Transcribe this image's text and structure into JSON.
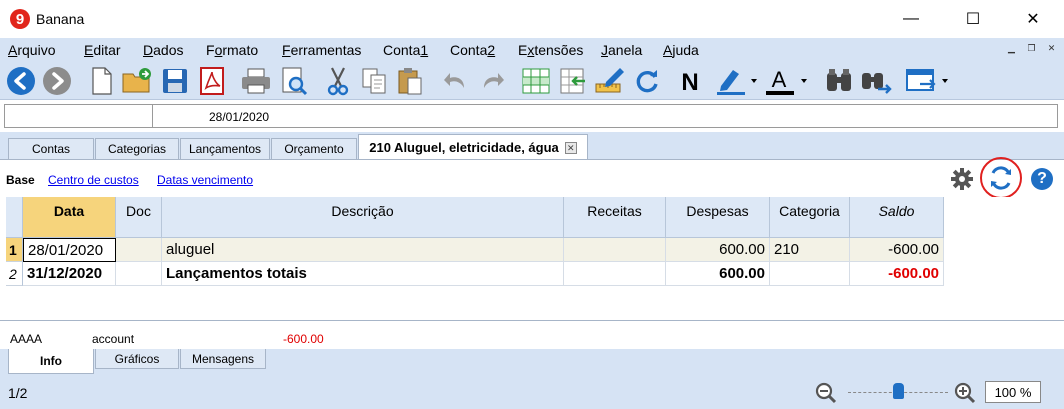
{
  "window": {
    "title": "Banana",
    "controls": {
      "minimize": "—",
      "maximize": "☐",
      "close": "✕"
    }
  },
  "menu": {
    "items": [
      {
        "pre": "",
        "ul": "A",
        "post": "rquivo"
      },
      {
        "pre": "",
        "ul": "E",
        "post": "ditar"
      },
      {
        "pre": "",
        "ul": "D",
        "post": "ados"
      },
      {
        "pre": "F",
        "ul": "o",
        "post": "rmato"
      },
      {
        "pre": "",
        "ul": "F",
        "post": "erramentas"
      },
      {
        "pre": "Conta",
        "ul": "1",
        "post": ""
      },
      {
        "pre": "Conta",
        "ul": "2",
        "post": ""
      },
      {
        "pre": "E",
        "ul": "x",
        "post": "tensões"
      },
      {
        "pre": "",
        "ul": "J",
        "post": "anela"
      },
      {
        "pre": "",
        "ul": "A",
        "post": "juda"
      }
    ],
    "subwindow_controls": [
      "▁",
      "❐",
      "✕"
    ]
  },
  "editbar": {
    "cell_ref": "",
    "cell_value": "28/01/2020"
  },
  "tabs": [
    {
      "label": "Contas"
    },
    {
      "label": "Categorias"
    },
    {
      "label": "Lançamentos"
    },
    {
      "label": "Orçamento"
    },
    {
      "label": "210 Aluguel, eletricidade, água",
      "close": "✕"
    }
  ],
  "views": {
    "current": "Base",
    "links": [
      "Centro de custos",
      "Datas vencimento"
    ]
  },
  "table": {
    "headers": {
      "date": "Data",
      "doc": "Doc",
      "description": "Descrição",
      "income": "Receitas",
      "expenses": "Despesas",
      "category": "Categoria",
      "balance": "Saldo"
    },
    "rows": [
      {
        "num": "1",
        "date": "28/01/2020",
        "doc": "",
        "description": "aluguel",
        "income": "",
        "expenses": "600.00",
        "category": "210",
        "balance": "-600.00"
      },
      {
        "num": "2",
        "date": "31/12/2020",
        "doc": "",
        "description": "Lançamentos totais",
        "income": "",
        "expenses": "600.00",
        "category": "",
        "balance": "-600.00"
      }
    ]
  },
  "info": {
    "code": "AAAA",
    "type": "account",
    "value": "-600.00"
  },
  "bottom_tabs": [
    {
      "label": "Info"
    },
    {
      "label": "Gráficos"
    },
    {
      "label": "Mensagens"
    }
  ],
  "status": {
    "page": "1/2",
    "zoom": "100 %",
    "zoom_level": 0.5
  },
  "colors": {
    "chrome": "#d6e3f4",
    "accent_blue": "#1f6fc4",
    "negative": "#e00000",
    "header_selected": "#f6d47c",
    "highlight_circle": "#e0201f"
  }
}
